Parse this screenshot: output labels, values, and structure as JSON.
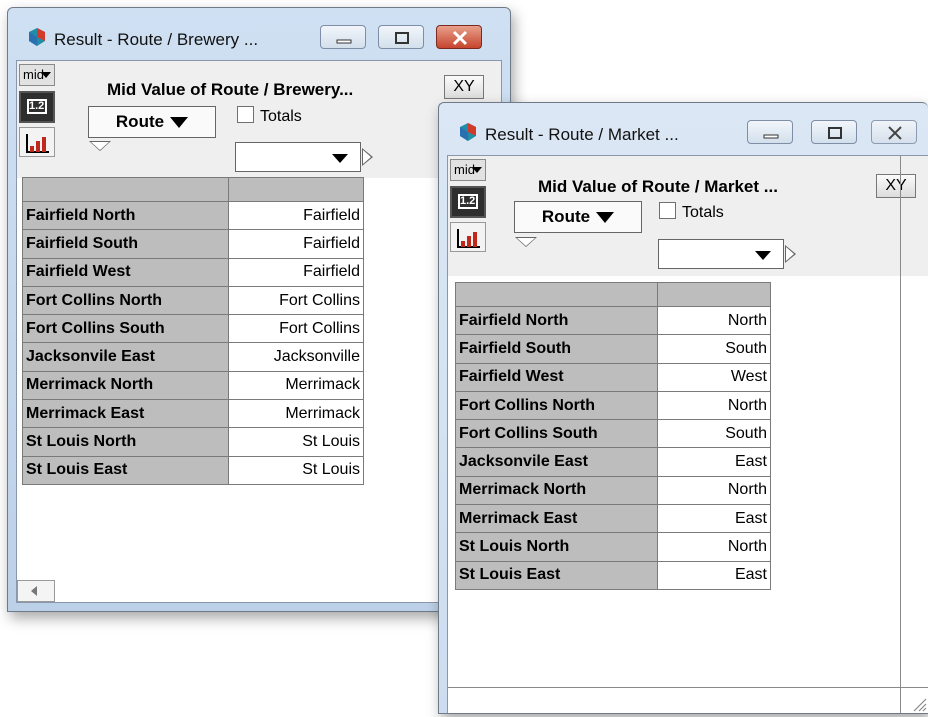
{
  "windows": [
    {
      "title": "Result - Route / Brewery ...",
      "mid_label": "mid",
      "table_icon_label": "1.2",
      "result_title": "Mid Value of Route / Brewery...",
      "xy_label": "XY",
      "route_label": "Route",
      "totals_label": "Totals",
      "rows": [
        {
          "route": "Fairfield North",
          "value": "Fairfield"
        },
        {
          "route": "Fairfield South",
          "value": "Fairfield"
        },
        {
          "route": "Fairfield West",
          "value": "Fairfield"
        },
        {
          "route": "Fort Collins North",
          "value": "Fort Collins"
        },
        {
          "route": "Fort Collins South",
          "value": "Fort Collins"
        },
        {
          "route": "Jacksonvile East",
          "value": "Jacksonville"
        },
        {
          "route": "Merrimack North",
          "value": "Merrimack"
        },
        {
          "route": "Merrimack East",
          "value": "Merrimack"
        },
        {
          "route": "St Louis North",
          "value": "St Louis"
        },
        {
          "route": "St Louis East",
          "value": "St Louis"
        }
      ]
    },
    {
      "title": "Result - Route / Market ...",
      "mid_label": "mid",
      "table_icon_label": "1.2",
      "result_title": "Mid Value of Route / Market ...",
      "xy_label": "XY",
      "route_label": "Route",
      "totals_label": "Totals",
      "rows": [
        {
          "route": "Fairfield North",
          "value": "North"
        },
        {
          "route": "Fairfield South",
          "value": "South"
        },
        {
          "route": "Fairfield West",
          "value": "West"
        },
        {
          "route": "Fort Collins North",
          "value": "North"
        },
        {
          "route": "Fort Collins South",
          "value": "South"
        },
        {
          "route": "Jacksonvile East",
          "value": "East"
        },
        {
          "route": "Merrimack North",
          "value": "North"
        },
        {
          "route": "Merrimack East",
          "value": "East"
        },
        {
          "route": "St Louis North",
          "value": "North"
        },
        {
          "route": "St Louis East",
          "value": "East"
        }
      ]
    }
  ],
  "colors": {
    "titlebar": "#c4d6ec",
    "close_active": "#c6452e",
    "header_cell": "#bdbdbd",
    "toolbar_bg": "#efefef"
  },
  "icons": [
    "app-icon",
    "minimize-icon",
    "maximize-icon",
    "close-icon",
    "table-view-icon",
    "graph-view-icon",
    "resize-grip-icon"
  ]
}
